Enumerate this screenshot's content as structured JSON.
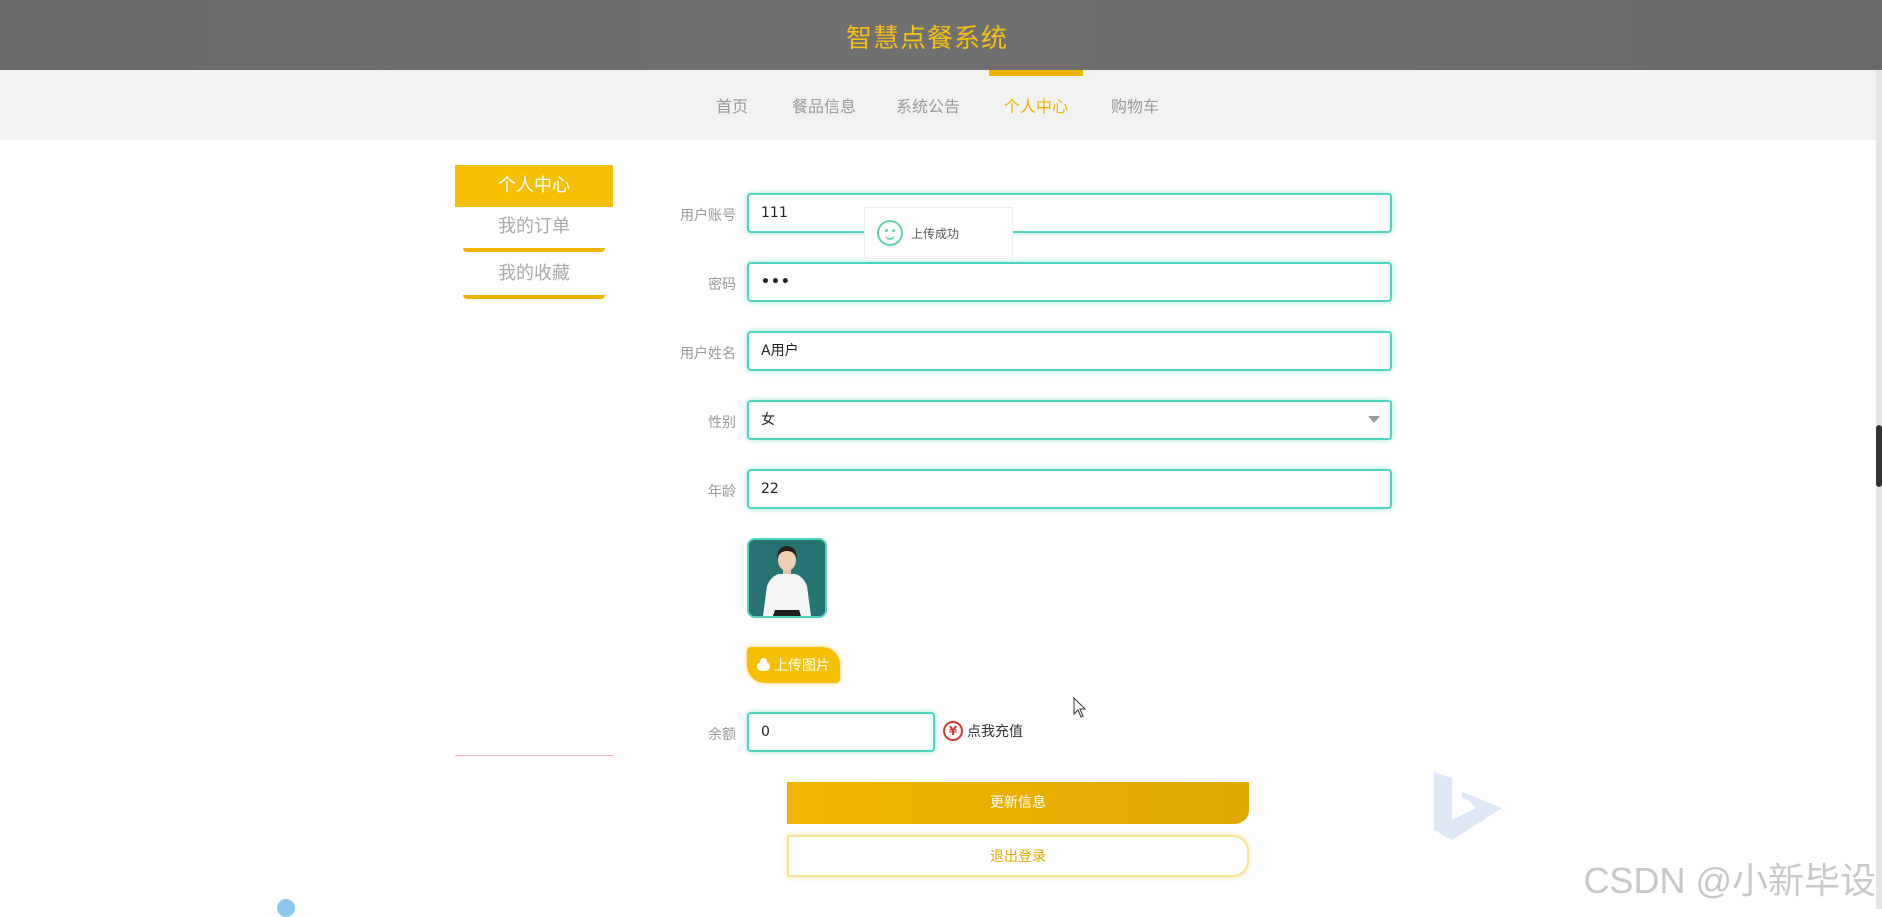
{
  "header": {
    "title": "智慧点餐系统"
  },
  "nav": {
    "items": [
      {
        "label": "首页"
      },
      {
        "label": "餐品信息"
      },
      {
        "label": "系统公告"
      },
      {
        "label": "个人中心",
        "active": true
      },
      {
        "label": "购物车"
      }
    ]
  },
  "sidebar": {
    "title": "个人中心",
    "items": [
      {
        "label": "我的订单"
      },
      {
        "label": "我的收藏"
      }
    ]
  },
  "toast": {
    "message": "上传成功"
  },
  "form": {
    "account": {
      "label": "用户账号",
      "value": "111"
    },
    "password": {
      "label": "密码",
      "value": "•••"
    },
    "name": {
      "label": "用户姓名",
      "value": "A用户"
    },
    "gender": {
      "label": "性别",
      "value": "女"
    },
    "age": {
      "label": "年龄",
      "value": "22"
    },
    "upload_label": "上传图片",
    "balance": {
      "label": "余额",
      "value": "0"
    },
    "recharge_label": "点我充值",
    "recharge_icon": "yen-icon",
    "update_label": "更新信息",
    "logout_label": "退出登录"
  },
  "watermark": "CSDN @小新毕设",
  "colors": {
    "accent": "#f0b400",
    "header_bg": "#6a6a6a",
    "nav_bg": "#f2f2f2",
    "input_border": "#4fd4c0",
    "recharge": "#d33a3a"
  }
}
